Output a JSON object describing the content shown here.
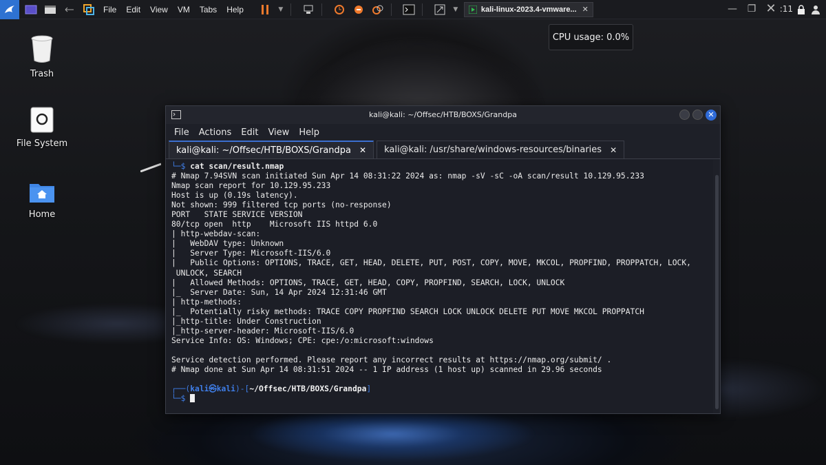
{
  "topbar": {
    "menu": [
      "File",
      "Edit",
      "View",
      "VM",
      "Tabs",
      "Help"
    ],
    "vm_tab_label": "kali-linux-2023.4-vmware...",
    "clock": ":11"
  },
  "tooltip": {
    "cpu_usage": "CPU usage: 0.0%"
  },
  "desktop": {
    "icons": [
      {
        "label": "Trash"
      },
      {
        "label": "File System"
      },
      {
        "label": "Home"
      }
    ]
  },
  "terminal": {
    "title": "kali@kali: ~/Offsec/HTB/BOXS/Grandpa",
    "menu": [
      "File",
      "Actions",
      "Edit",
      "View",
      "Help"
    ],
    "tabs": [
      {
        "label": "kali@kali: ~/Offsec/HTB/BOXS/Grandpa",
        "active": true
      },
      {
        "label": "kali@kali: /usr/share/windows-resources/binaries",
        "active": false
      }
    ],
    "command": {
      "prompt_tail": "└─$ ",
      "text": "cat scan/result.nmap"
    },
    "output": [
      "# Nmap 7.94SVN scan initiated Sun Apr 14 08:31:22 2024 as: nmap -sV -sC -oA scan/result 10.129.95.233",
      "Nmap scan report for 10.129.95.233",
      "Host is up (0.19s latency).",
      "Not shown: 999 filtered tcp ports (no-response)",
      "PORT   STATE SERVICE VERSION",
      "80/tcp open  http    Microsoft IIS httpd 6.0",
      "| http-webdav-scan: ",
      "|   WebDAV type: Unknown",
      "|   Server Type: Microsoft-IIS/6.0",
      "|   Public Options: OPTIONS, TRACE, GET, HEAD, DELETE, PUT, POST, COPY, MOVE, MKCOL, PROPFIND, PROPPATCH, LOCK,",
      " UNLOCK, SEARCH",
      "|   Allowed Methods: OPTIONS, TRACE, GET, HEAD, COPY, PROPFIND, SEARCH, LOCK, UNLOCK",
      "|_  Server Date: Sun, 14 Apr 2024 12:31:46 GMT",
      "| http-methods: ",
      "|_  Potentially risky methods: TRACE COPY PROPFIND SEARCH LOCK UNLOCK DELETE PUT MOVE MKCOL PROPPATCH",
      "|_http-title: Under Construction",
      "|_http-server-header: Microsoft-IIS/6.0",
      "Service Info: OS: Windows; CPE: cpe:/o:microsoft:windows",
      "",
      "Service detection performed. Please report any incorrect results at https://nmap.org/submit/ .",
      "# Nmap done at Sun Apr 14 08:31:51 2024 -- 1 IP address (1 host up) scanned in 29.96 seconds",
      ""
    ],
    "prompt": {
      "line1_prefix": "┌──(",
      "user": "kali㉿kali",
      "line1_mid": ")-[",
      "path": "~/Offsec/HTB/BOXS/Grandpa",
      "line1_suffix": "]",
      "line2": "└─$ "
    }
  }
}
